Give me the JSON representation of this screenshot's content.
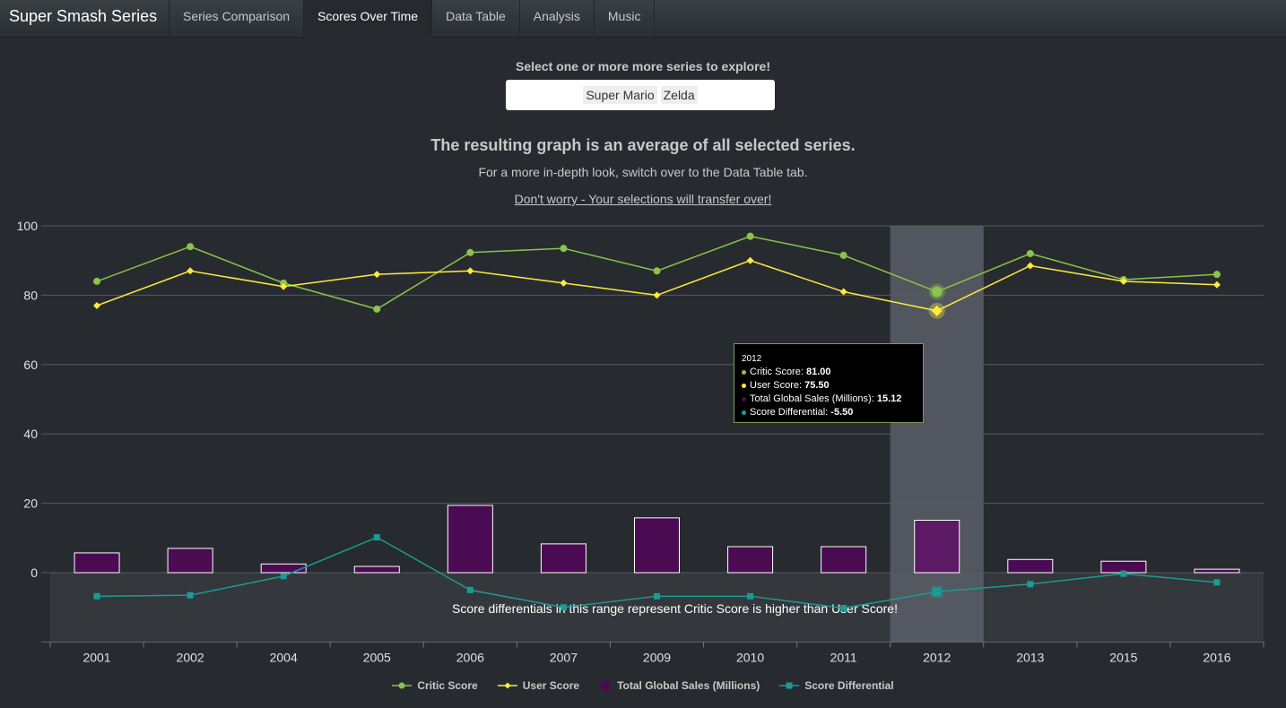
{
  "navbar": {
    "brand": "Super Smash Series",
    "tabs": [
      {
        "label": "Series Comparison",
        "active": false
      },
      {
        "label": "Scores Over Time",
        "active": true
      },
      {
        "label": "Data Table",
        "active": false
      },
      {
        "label": "Analysis",
        "active": false
      },
      {
        "label": "Music",
        "active": false
      }
    ]
  },
  "controls": {
    "select_label": "Select one or more more series to explore!",
    "selected": [
      "Super Mario",
      "Zelda"
    ]
  },
  "intro": {
    "headline": "The resulting graph is an average of all selected series.",
    "subline": "For a more in-depth look, switch over to the Data Table tab.",
    "link": "Don't worry - Your selections will transfer over!"
  },
  "chart_data": {
    "type": "line",
    "categories": [
      "2001",
      "2002",
      "2004",
      "2005",
      "2006",
      "2007",
      "2009",
      "2010",
      "2011",
      "2012",
      "2013",
      "2015",
      "2016"
    ],
    "ylim": [
      -20,
      100
    ],
    "yticks": [
      0,
      20,
      40,
      60,
      80,
      100
    ],
    "grid": true,
    "highlight_category": "2012",
    "negative_region_text": "Score differentials in this range represent Critic Score is higher than User Score!",
    "series": [
      {
        "name": "Critic Score",
        "type": "line",
        "color": "#8bc34a",
        "marker": "circle",
        "values": [
          84,
          94,
          83.5,
          76,
          92.3,
          93.5,
          87,
          97,
          91.5,
          81,
          92,
          84.5,
          86
        ]
      },
      {
        "name": "User Score",
        "type": "line",
        "color": "#ffeb3b",
        "marker": "diamond",
        "values": [
          77,
          87,
          82.5,
          86,
          87,
          83.5,
          80,
          90,
          81,
          75.5,
          88.5,
          84,
          83
        ]
      },
      {
        "name": "Total Global Sales (Millions)",
        "type": "bar",
        "color": "#4a0b52",
        "values": [
          5.7,
          7,
          2.5,
          1.8,
          19.4,
          8.3,
          15.8,
          7.5,
          7.5,
          15.12,
          3.8,
          3.3,
          1
        ]
      },
      {
        "name": "Score Differential",
        "type": "line",
        "color": "#1a9b95",
        "marker": "square",
        "values": [
          -6.8,
          -6.5,
          -1,
          10.2,
          -5,
          -10,
          -6.8,
          -6.8,
          -10.2,
          -5.5,
          -3.3,
          -0.3,
          -2.8
        ]
      }
    ]
  },
  "tooltip": {
    "title": "2012",
    "rows": [
      {
        "label": "Critic Score: ",
        "value": "81.00",
        "color": "#8bc34a"
      },
      {
        "label": "User Score: ",
        "value": "75.50",
        "color": "#ffeb3b"
      },
      {
        "label": "Total Global Sales (Millions): ",
        "value": "15.12",
        "color": "#4a0b52"
      },
      {
        "label": "Score Differential: ",
        "value": "-5.50",
        "color": "#1a9b95"
      }
    ]
  }
}
